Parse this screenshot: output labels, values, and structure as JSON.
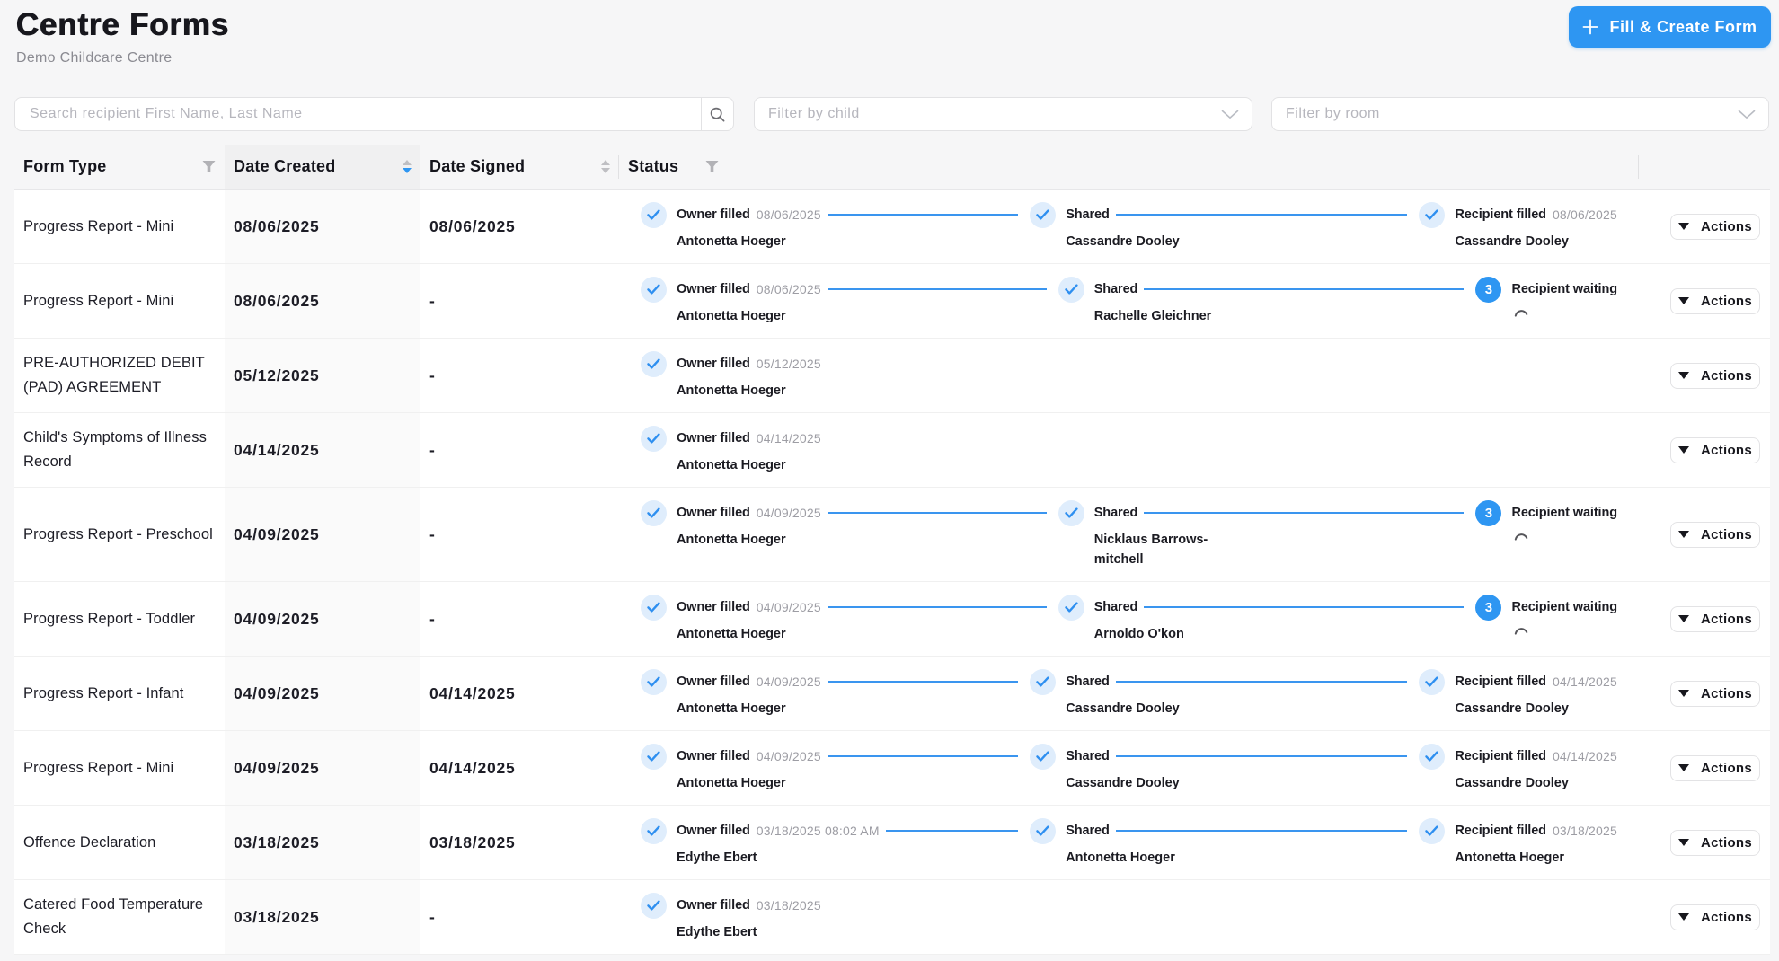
{
  "app": {
    "title": "Centre Forms",
    "subtitle": "Demo Childcare Centre"
  },
  "toolbar": {
    "create_button_label": "Fill & Create Form"
  },
  "filters": {
    "search": {
      "placeholder": "Search recipient First Name, Last Name",
      "value": ""
    },
    "child": {
      "placeholder": "Filter by child",
      "value": ""
    },
    "room": {
      "placeholder": "Filter by room",
      "value": ""
    }
  },
  "table": {
    "columns": [
      {
        "key": "form_type",
        "label": "Form Type",
        "filterable": true
      },
      {
        "key": "date_created",
        "label": "Date Created",
        "sortable": true,
        "sort_active": "descend"
      },
      {
        "key": "date_signed",
        "label": "Date Signed",
        "sortable": true,
        "sort_active": null
      },
      {
        "key": "status",
        "label": "Status",
        "filterable": true
      },
      {
        "key": "actions",
        "label": ""
      }
    ],
    "actions_button_label": "Actions",
    "rows": [
      {
        "form_type": "Progress Report - Mini",
        "date_created": "08/06/2025",
        "date_signed": "08/06/2025",
        "steps": [
          {
            "state": "done",
            "label": "Owner filled",
            "date": "08/06/2025",
            "name": "Antonetta Hoeger"
          },
          {
            "state": "done",
            "label": "Shared",
            "date": "",
            "name": "Cassandre Dooley"
          },
          {
            "state": "done",
            "label": "Recipient filled",
            "date": "08/06/2025",
            "name": "Cassandre Dooley"
          }
        ]
      },
      {
        "form_type": "Progress Report - Mini",
        "date_created": "08/06/2025",
        "date_signed": "-",
        "steps": [
          {
            "state": "done",
            "label": "Owner filled",
            "date": "08/06/2025",
            "name": "Antonetta Hoeger"
          },
          {
            "state": "done",
            "label": "Shared",
            "date": "",
            "name": "Rachelle Gleichner"
          },
          {
            "state": "waiting",
            "count": "3",
            "label": "Recipient waiting",
            "date": "",
            "name": ""
          }
        ]
      },
      {
        "form_type": "PRE-AUTHORIZED DEBIT (PAD) AGREEMENT",
        "date_created": "05/12/2025",
        "date_signed": "-",
        "steps": [
          {
            "state": "done",
            "label": "Owner filled",
            "date": "05/12/2025",
            "name": "Antonetta Hoeger"
          }
        ]
      },
      {
        "form_type": "Child's Symptoms of Illness Record",
        "date_created": "04/14/2025",
        "date_signed": "-",
        "steps": [
          {
            "state": "done",
            "label": "Owner filled",
            "date": "04/14/2025",
            "name": "Antonetta Hoeger"
          }
        ]
      },
      {
        "form_type": "Progress Report - Preschool",
        "date_created": "04/09/2025",
        "date_signed": "-",
        "steps": [
          {
            "state": "done",
            "label": "Owner filled",
            "date": "04/09/2025",
            "name": "Antonetta Hoeger"
          },
          {
            "state": "done",
            "label": "Shared",
            "date": "",
            "name": "Nicklaus Barrows-mitchell"
          },
          {
            "state": "waiting",
            "count": "3",
            "label": "Recipient waiting",
            "date": "",
            "name": ""
          }
        ]
      },
      {
        "form_type": "Progress Report - Toddler",
        "date_created": "04/09/2025",
        "date_signed": "-",
        "steps": [
          {
            "state": "done",
            "label": "Owner filled",
            "date": "04/09/2025",
            "name": "Antonetta Hoeger"
          },
          {
            "state": "done",
            "label": "Shared",
            "date": "",
            "name": "Arnoldo O'kon"
          },
          {
            "state": "waiting",
            "count": "3",
            "label": "Recipient waiting",
            "date": "",
            "name": ""
          }
        ]
      },
      {
        "form_type": "Progress Report - Infant",
        "date_created": "04/09/2025",
        "date_signed": "04/14/2025",
        "steps": [
          {
            "state": "done",
            "label": "Owner filled",
            "date": "04/09/2025",
            "name": "Antonetta Hoeger"
          },
          {
            "state": "done",
            "label": "Shared",
            "date": "",
            "name": "Cassandre Dooley"
          },
          {
            "state": "done",
            "label": "Recipient filled",
            "date": "04/14/2025",
            "name": "Cassandre Dooley"
          }
        ]
      },
      {
        "form_type": "Progress Report - Mini",
        "date_created": "04/09/2025",
        "date_signed": "04/14/2025",
        "steps": [
          {
            "state": "done",
            "label": "Owner filled",
            "date": "04/09/2025",
            "name": "Antonetta Hoeger"
          },
          {
            "state": "done",
            "label": "Shared",
            "date": "",
            "name": "Cassandre Dooley"
          },
          {
            "state": "done",
            "label": "Recipient filled",
            "date": "04/14/2025",
            "name": "Cassandre Dooley"
          }
        ]
      },
      {
        "form_type": "Offence Declaration",
        "date_created": "03/18/2025",
        "date_signed": "03/18/2025",
        "steps": [
          {
            "state": "done",
            "label": "Owner filled",
            "date": "03/18/2025 08:02 AM",
            "name": "Edythe Ebert"
          },
          {
            "state": "done",
            "label": "Shared",
            "date": "",
            "name": "Antonetta Hoeger"
          },
          {
            "state": "done",
            "label": "Recipient filled",
            "date": "03/18/2025",
            "name": "Antonetta Hoeger"
          }
        ]
      },
      {
        "form_type": "Catered Food Temperature Check",
        "date_created": "03/18/2025",
        "date_signed": "-",
        "steps": [
          {
            "state": "done",
            "label": "Owner filled",
            "date": "03/18/2025",
            "name": "Edythe Ebert"
          }
        ]
      }
    ]
  },
  "colors": {
    "accent_blue": "#2e96f2",
    "check_circle_bg": "#ddebfb",
    "page_bg": "#f6f6f7",
    "sorted_column_bg": "#fafafa"
  }
}
